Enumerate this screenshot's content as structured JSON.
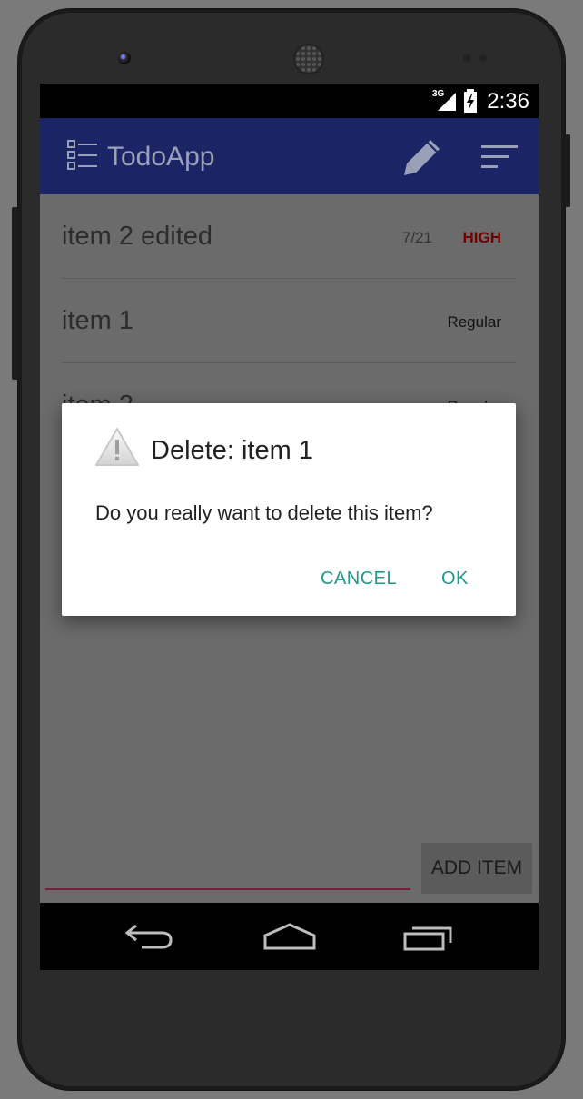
{
  "status_bar": {
    "network": "3G",
    "time": "2:36"
  },
  "app_bar": {
    "title": "TodoApp"
  },
  "items": [
    {
      "name": "item 2 edited",
      "date": "7/21",
      "priority": "HIGH"
    },
    {
      "name": "item 1",
      "date": "",
      "priority": "Regular"
    },
    {
      "name": "item 2",
      "date": "",
      "priority": "Regular"
    }
  ],
  "footer": {
    "add_button": "ADD ITEM"
  },
  "dialog": {
    "title": "Delete: item 1",
    "message": "Do you really want to delete this item?",
    "cancel": "CANCEL",
    "ok": "OK"
  },
  "colors": {
    "app_bar": "#1b2565",
    "accent": "#1e9a8a",
    "high_priority": "#6e0000",
    "input_underline": "#7b1e3e"
  },
  "icons": [
    "list-icon",
    "pencil-icon",
    "sort-icon",
    "warning-icon",
    "back-icon",
    "home-icon",
    "recent-apps-icon"
  ]
}
